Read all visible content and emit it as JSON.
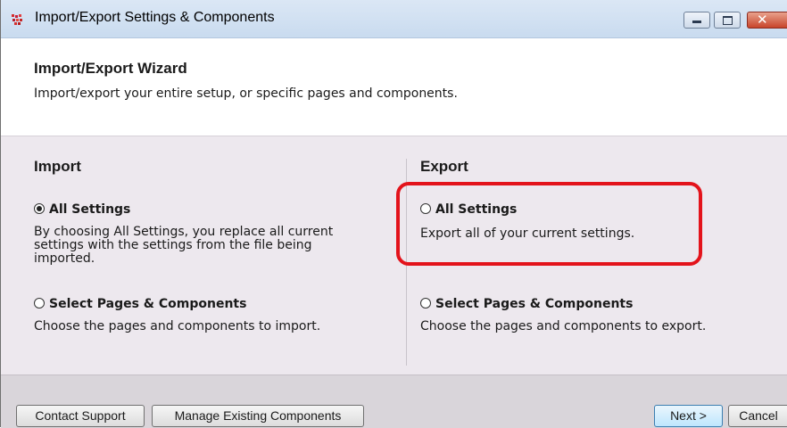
{
  "window": {
    "title": "Import/Export Settings & Components"
  },
  "header": {
    "title": "Import/Export Wizard",
    "subtitle": "Import/export your entire setup, or specific pages and components."
  },
  "import": {
    "heading": "Import",
    "all_settings": {
      "label": "All Settings",
      "selected": true,
      "description_lines": [
        "By choosing All Settings, you replace all current",
        "settings with the settings from the file being",
        "imported."
      ]
    },
    "select_pages": {
      "label": "Select Pages & Components",
      "selected": false,
      "description": "Choose the pages and components to import."
    }
  },
  "export": {
    "heading": "Export",
    "all_settings": {
      "label": "All Settings",
      "selected": false,
      "description": "Export all of your current settings."
    },
    "select_pages": {
      "label": "Select Pages & Components",
      "selected": false,
      "description": "Choose the pages and components to export."
    }
  },
  "footer": {
    "contact_support": "Contact Support",
    "manage_components": "Manage Existing Components",
    "next": "Next >",
    "cancel": "Cancel"
  },
  "colors": {
    "highlight": "#e3131b",
    "panel_bg": "#ede8ee"
  }
}
